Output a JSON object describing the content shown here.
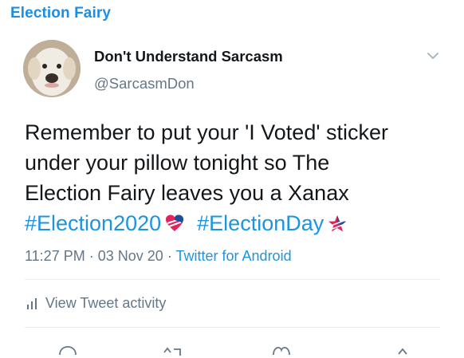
{
  "caption": "Election Fairy",
  "tweet": {
    "display_name": "Don't Understand Sarcasm",
    "handle": "@SarcasmDon",
    "text_lines": [
      "Remember to put your 'I Voted' sticker",
      "under your pillow tonight so The",
      "Election Fairy leaves you a Xanax"
    ],
    "hashtags": [
      "#Election2020",
      "#ElectionDay"
    ],
    "time": "11:27 PM",
    "date": "03 Nov 20",
    "separator": "·",
    "source": "Twitter for Android",
    "activity_label": "View Tweet activity"
  },
  "colors": {
    "caption": "#1d8fe3",
    "link": "#1b95e0",
    "secondary_text": "#657786",
    "divider": "#e6ecf0"
  },
  "icons": {
    "more": "chevron-down-icon",
    "activity": "bar-chart-icon",
    "actions": [
      "reply-icon",
      "retweet-icon",
      "like-icon",
      "share-icon"
    ]
  }
}
